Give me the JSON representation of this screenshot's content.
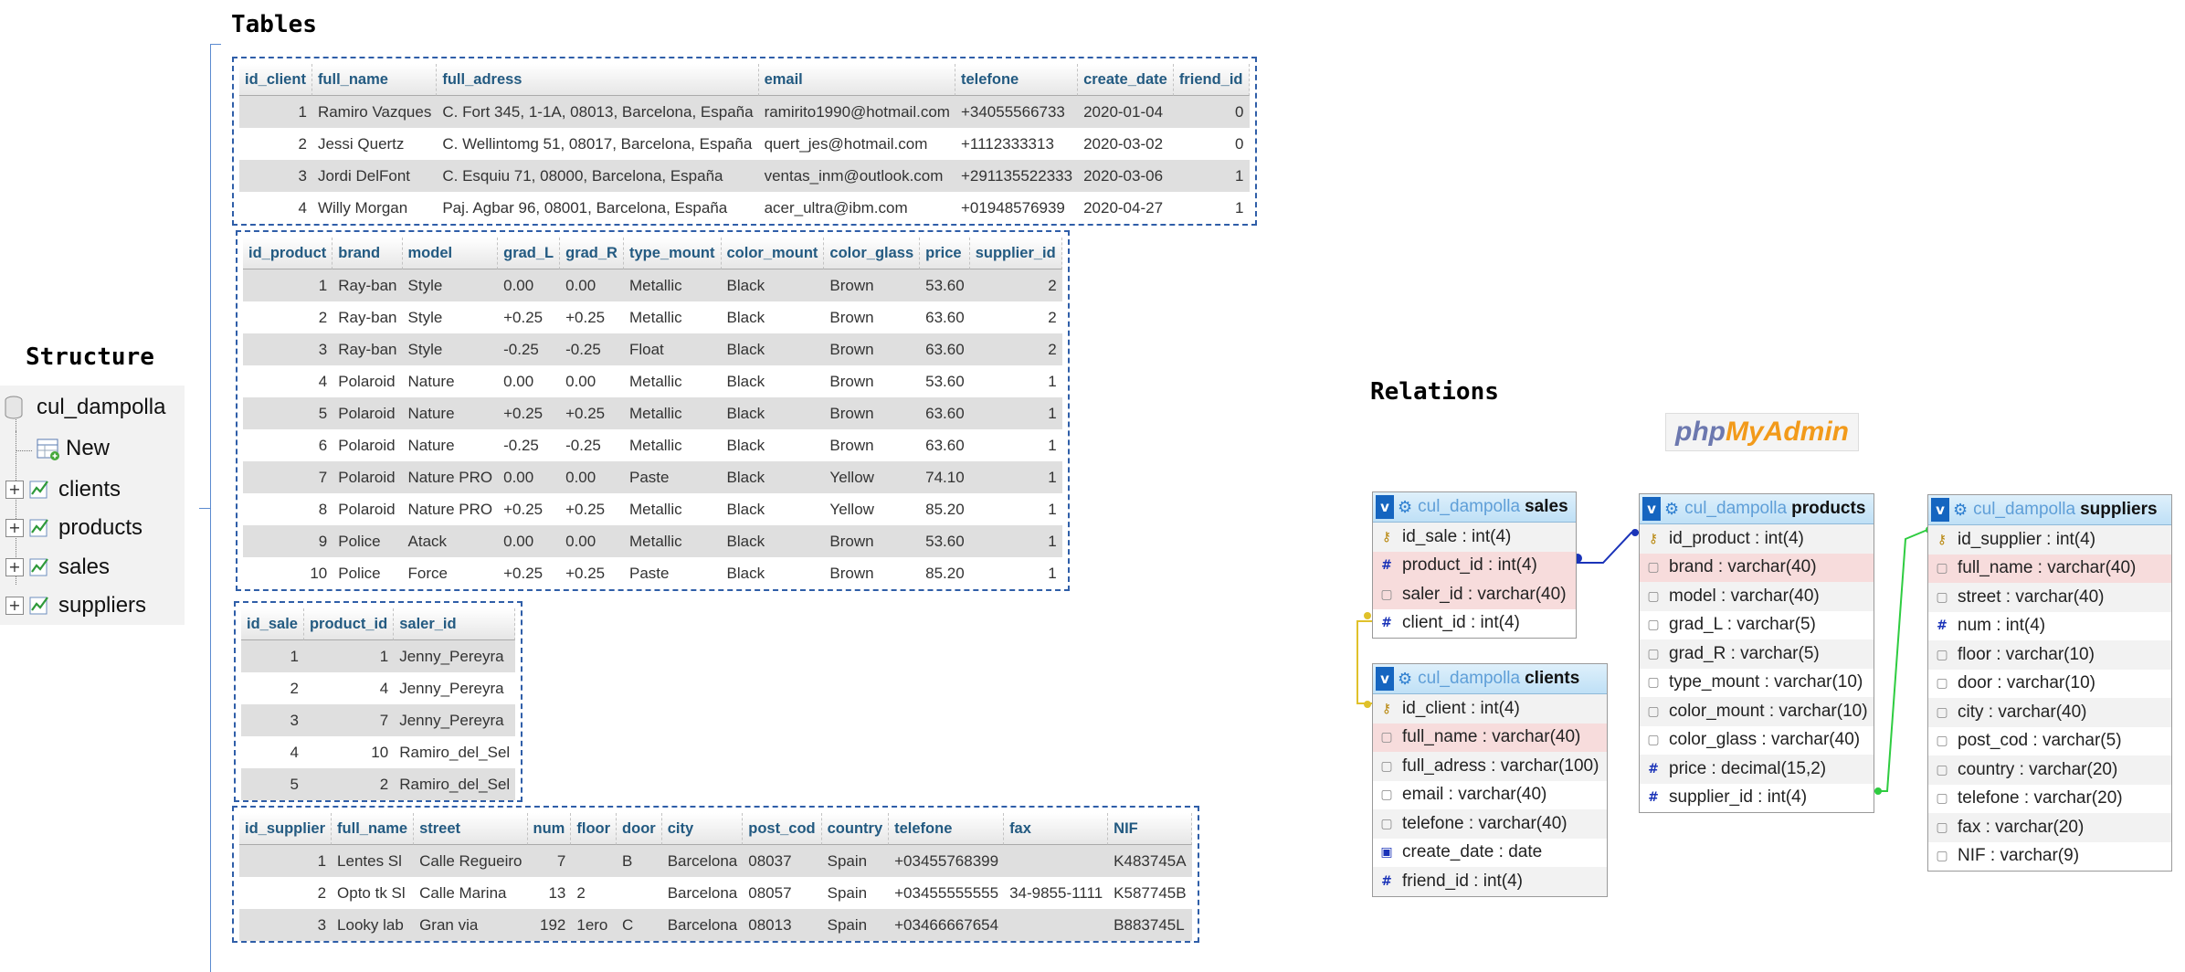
{
  "headings": {
    "structure": "Structure",
    "tables": "Tables",
    "relations": "Relations"
  },
  "structure": {
    "database": "cul_dampolla",
    "new_item": "New",
    "tables": [
      "clients",
      "products",
      "sales",
      "suppliers"
    ]
  },
  "clients_table": {
    "columns": [
      "id_client",
      "full_name",
      "full_adress",
      "email",
      "telefone",
      "create_date",
      "friend_id"
    ],
    "rows": [
      [
        "1",
        "Ramiro Vazques",
        "C. Fort 345, 1-1A, 08013, Barcelona, España",
        "ramirito1990@hotmail.com",
        "+34055566733",
        "2020-01-04",
        "0"
      ],
      [
        "2",
        "Jessi Quertz",
        "C. Wellintomg 51, 08017, Barcelona, España",
        "quert_jes@hotmail.com",
        "+1112333313",
        "2020-03-02",
        "0"
      ],
      [
        "3",
        "Jordi DelFont",
        "C. Esquiu 71, 08000, Barcelona, España",
        "ventas_inm@outlook.com",
        "+291135522333",
        "2020-03-06",
        "1"
      ],
      [
        "4",
        "Willy Morgan",
        "Paj. Agbar 96, 08001, Barcelona, España",
        "acer_ultra@ibm.com",
        "+01948576939",
        "2020-04-27",
        "1"
      ]
    ]
  },
  "products_table": {
    "columns": [
      "id_product",
      "brand",
      "model",
      "grad_L",
      "grad_R",
      "type_mount",
      "color_mount",
      "color_glass",
      "price",
      "supplier_id"
    ],
    "rows": [
      [
        "1",
        "Ray-ban",
        "Style",
        "0.00",
        "0.00",
        "Metallic",
        "Black",
        "Brown",
        "53.60",
        "2"
      ],
      [
        "2",
        "Ray-ban",
        "Style",
        "+0.25",
        "+0.25",
        "Metallic",
        "Black",
        "Brown",
        "63.60",
        "2"
      ],
      [
        "3",
        "Ray-ban",
        "Style",
        "-0.25",
        "-0.25",
        "Float",
        "Black",
        "Brown",
        "63.60",
        "2"
      ],
      [
        "4",
        "Polaroid",
        "Nature",
        "0.00",
        "0.00",
        "Metallic",
        "Black",
        "Brown",
        "53.60",
        "1"
      ],
      [
        "5",
        "Polaroid",
        "Nature",
        "+0.25",
        "+0.25",
        "Metallic",
        "Black",
        "Brown",
        "63.60",
        "1"
      ],
      [
        "6",
        "Polaroid",
        "Nature",
        "-0.25",
        "-0.25",
        "Metallic",
        "Black",
        "Brown",
        "63.60",
        "1"
      ],
      [
        "7",
        "Polaroid",
        "Nature PRO",
        "0.00",
        "0.00",
        "Paste",
        "Black",
        "Yellow",
        "74.10",
        "1"
      ],
      [
        "8",
        "Polaroid",
        "Nature PRO",
        "+0.25",
        "+0.25",
        "Metallic",
        "Black",
        "Yellow",
        "85.20",
        "1"
      ],
      [
        "9",
        "Police",
        "Atack",
        "0.00",
        "0.00",
        "Metallic",
        "Black",
        "Brown",
        "53.60",
        "1"
      ],
      [
        "10",
        "Police",
        "Force",
        "+0.25",
        "+0.25",
        "Paste",
        "Black",
        "Brown",
        "85.20",
        "1"
      ]
    ]
  },
  "sales_table": {
    "columns": [
      "id_sale",
      "product_id",
      "saler_id"
    ],
    "rows": [
      [
        "1",
        "1",
        "Jenny_Pereyra"
      ],
      [
        "2",
        "4",
        "Jenny_Pereyra"
      ],
      [
        "3",
        "7",
        "Jenny_Pereyra"
      ],
      [
        "4",
        "10",
        "Ramiro_del_Sel"
      ],
      [
        "5",
        "2",
        "Ramiro_del_Sel"
      ]
    ]
  },
  "suppliers_table": {
    "columns": [
      "id_supplier",
      "full_name",
      "street",
      "num",
      "floor",
      "door",
      "city",
      "post_cod",
      "country",
      "telefone",
      "fax",
      "NIF"
    ],
    "rows": [
      [
        "1",
        "Lentes Sl",
        "Calle Regueiro",
        "7",
        "",
        "B",
        "Barcelona",
        "08037",
        "Spain",
        "+03455768399",
        "",
        "K483745A"
      ],
      [
        "2",
        "Opto tk Sl",
        "Calle Marina",
        "13",
        "2",
        "",
        "Barcelona",
        "08057",
        "Spain",
        "+03455555555",
        "34-9855-1111",
        "K587745B"
      ],
      [
        "3",
        "Looky lab",
        "Gran via",
        "192",
        "1ero",
        "C",
        "Barcelona",
        "08013",
        "Spain",
        "+03466667654",
        "",
        "B883745L"
      ]
    ]
  },
  "logo": {
    "part1": "php",
    "part2": "MyAdmin"
  },
  "relations": {
    "db_prefix": "cul_dampolla",
    "sales": {
      "name": "sales",
      "fields": [
        {
          "icon": "key",
          "label": "id_sale : int(4)"
        },
        {
          "icon": "num",
          "label": "product_id : int(4)"
        },
        {
          "icon": "str",
          "label": "saler_id : varchar(40)"
        },
        {
          "icon": "num",
          "label": "client_id : int(4)"
        }
      ]
    },
    "clients": {
      "name": "clients",
      "fields": [
        {
          "icon": "key",
          "label": "id_client : int(4)"
        },
        {
          "icon": "str",
          "label": "full_name : varchar(40)"
        },
        {
          "icon": "str",
          "label": "full_adress : varchar(100)"
        },
        {
          "icon": "str",
          "label": "email : varchar(40)"
        },
        {
          "icon": "str",
          "label": "telefone : varchar(40)"
        },
        {
          "icon": "date",
          "label": "create_date : date"
        },
        {
          "icon": "num",
          "label": "friend_id : int(4)"
        }
      ]
    },
    "products": {
      "name": "products",
      "fields": [
        {
          "icon": "key",
          "label": "id_product : int(4)"
        },
        {
          "icon": "str",
          "label": "brand : varchar(40)"
        },
        {
          "icon": "str",
          "label": "model : varchar(40)"
        },
        {
          "icon": "str",
          "label": "grad_L : varchar(5)"
        },
        {
          "icon": "str",
          "label": "grad_R : varchar(5)"
        },
        {
          "icon": "str",
          "label": "type_mount : varchar(10)"
        },
        {
          "icon": "str",
          "label": "color_mount : varchar(10)"
        },
        {
          "icon": "str",
          "label": "color_glass : varchar(40)"
        },
        {
          "icon": "num",
          "label": "price : decimal(15,2)"
        },
        {
          "icon": "num",
          "label": "supplier_id : int(4)"
        }
      ]
    },
    "suppliers": {
      "name": "suppliers",
      "fields": [
        {
          "icon": "key",
          "label": "id_supplier : int(4)"
        },
        {
          "icon": "str",
          "label": "full_name : varchar(40)"
        },
        {
          "icon": "str",
          "label": "street : varchar(40)"
        },
        {
          "icon": "num",
          "label": "num : int(4)"
        },
        {
          "icon": "str",
          "label": "floor : varchar(10)"
        },
        {
          "icon": "str",
          "label": "door : varchar(10)"
        },
        {
          "icon": "str",
          "label": "city : varchar(40)"
        },
        {
          "icon": "str",
          "label": "post_cod : varchar(5)"
        },
        {
          "icon": "str",
          "label": "country : varchar(20)"
        },
        {
          "icon": "str",
          "label": "telefone : varchar(20)"
        },
        {
          "icon": "str",
          "label": "fax : varchar(20)"
        },
        {
          "icon": "str",
          "label": "NIF : varchar(9)"
        }
      ]
    }
  },
  "colors": {
    "accent_blue": "#1565c0",
    "table_border": "#2f5ea8",
    "header_text": "#235a81",
    "link_line_blue": "#1a33b8",
    "link_line_yellow": "#e0c12a",
    "link_line_green": "#2ecc40"
  }
}
